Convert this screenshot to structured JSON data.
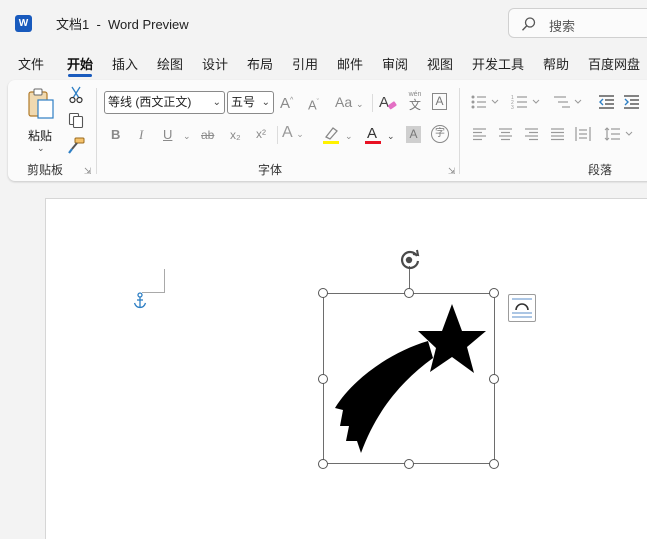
{
  "window": {
    "app_icon_letter": "W",
    "title": "文档1  -  Word Preview"
  },
  "search": {
    "label": "搜索"
  },
  "tabs": [
    {
      "label": "文件"
    },
    {
      "label": "开始"
    },
    {
      "label": "插入"
    },
    {
      "label": "绘图"
    },
    {
      "label": "设计"
    },
    {
      "label": "布局"
    },
    {
      "label": "引用"
    },
    {
      "label": "邮件"
    },
    {
      "label": "审阅"
    },
    {
      "label": "视图"
    },
    {
      "label": "开发工具"
    },
    {
      "label": "帮助"
    },
    {
      "label": "百度网盘"
    }
  ],
  "active_tab": "开始",
  "ribbon": {
    "clipboard": {
      "paste_label": "粘贴",
      "group_label": "剪贴板"
    },
    "font": {
      "font_name": "等线 (西文正文)",
      "font_size": "五号",
      "bold": "B",
      "italic": "I",
      "underline": "U",
      "strike": "ab",
      "subscript": "x₂",
      "superscript": "x²",
      "grow": "A",
      "shrink": "A",
      "case": "Aa",
      "phonetic_top": "wén",
      "phonetic_bottom": "文",
      "border_char": "A",
      "shade_char": "A",
      "color_char": "A",
      "enclose_char": "字",
      "group_label": "字体"
    },
    "paragraph": {
      "group_label": "段落"
    }
  },
  "colors": {
    "accent": "#185abd",
    "font_color_bar": "#e81123",
    "highlight_bar": "#fff200",
    "anchor": "#2e7fc4"
  },
  "document": {
    "anchor_icon": "anchor-icon",
    "shape": "shooting-star"
  }
}
